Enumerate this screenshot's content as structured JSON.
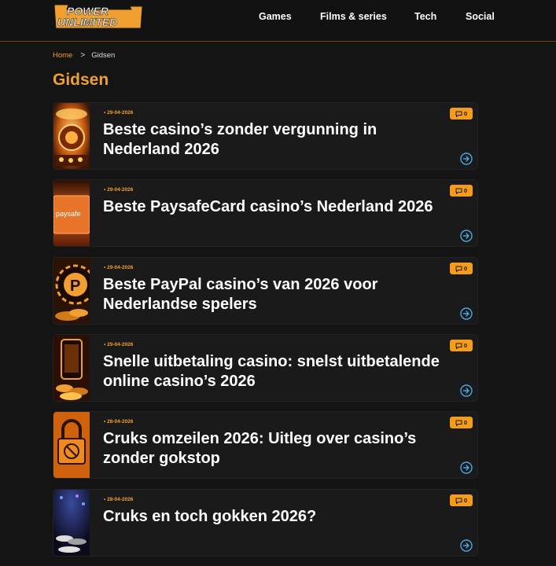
{
  "site": {
    "logo_line1": "POWER",
    "logo_line2": "UNLIMITED"
  },
  "nav": [
    "Games",
    "Films & series",
    "Tech",
    "Social"
  ],
  "breadcrumb": {
    "home": "Home",
    "separator": ">",
    "current": "Gidsen"
  },
  "page_title": "Gidsen",
  "articles": [
    {
      "date": "29-04-2026",
      "title": "Beste casino’s zonder vergunning in Nederland 2026",
      "comments": "0",
      "thumb": "casino-wheel"
    },
    {
      "date": "29-04-2026",
      "title": "Beste PaysafeCard casino’s Nederland 2026",
      "comments": "0",
      "thumb": "paysafecard"
    },
    {
      "date": "29-04-2026",
      "title": "Beste PayPal casino’s van 2026 voor Nederlandse spelers",
      "comments": "0",
      "thumb": "paypal-chip"
    },
    {
      "date": "29-04-2026",
      "title": "Snelle uitbetaling casino: snelst uitbetalende online casino’s 2026",
      "comments": "0",
      "thumb": "phone-coins"
    },
    {
      "date": "28-04-2026",
      "title": "Cruks omzeilen 2026: Uitleg over casino’s zonder gokstop",
      "comments": "0",
      "thumb": "padlock"
    },
    {
      "date": "28-04-2026",
      "title": "Cruks en toch gokken 2026?",
      "comments": "0",
      "thumb": "casino-chips"
    }
  ],
  "colors": {
    "accent": "#f0a030",
    "badge": "#f59c1a",
    "arrow": "#4aa8e0",
    "background": "#141414",
    "card": "#1a1a1a"
  }
}
